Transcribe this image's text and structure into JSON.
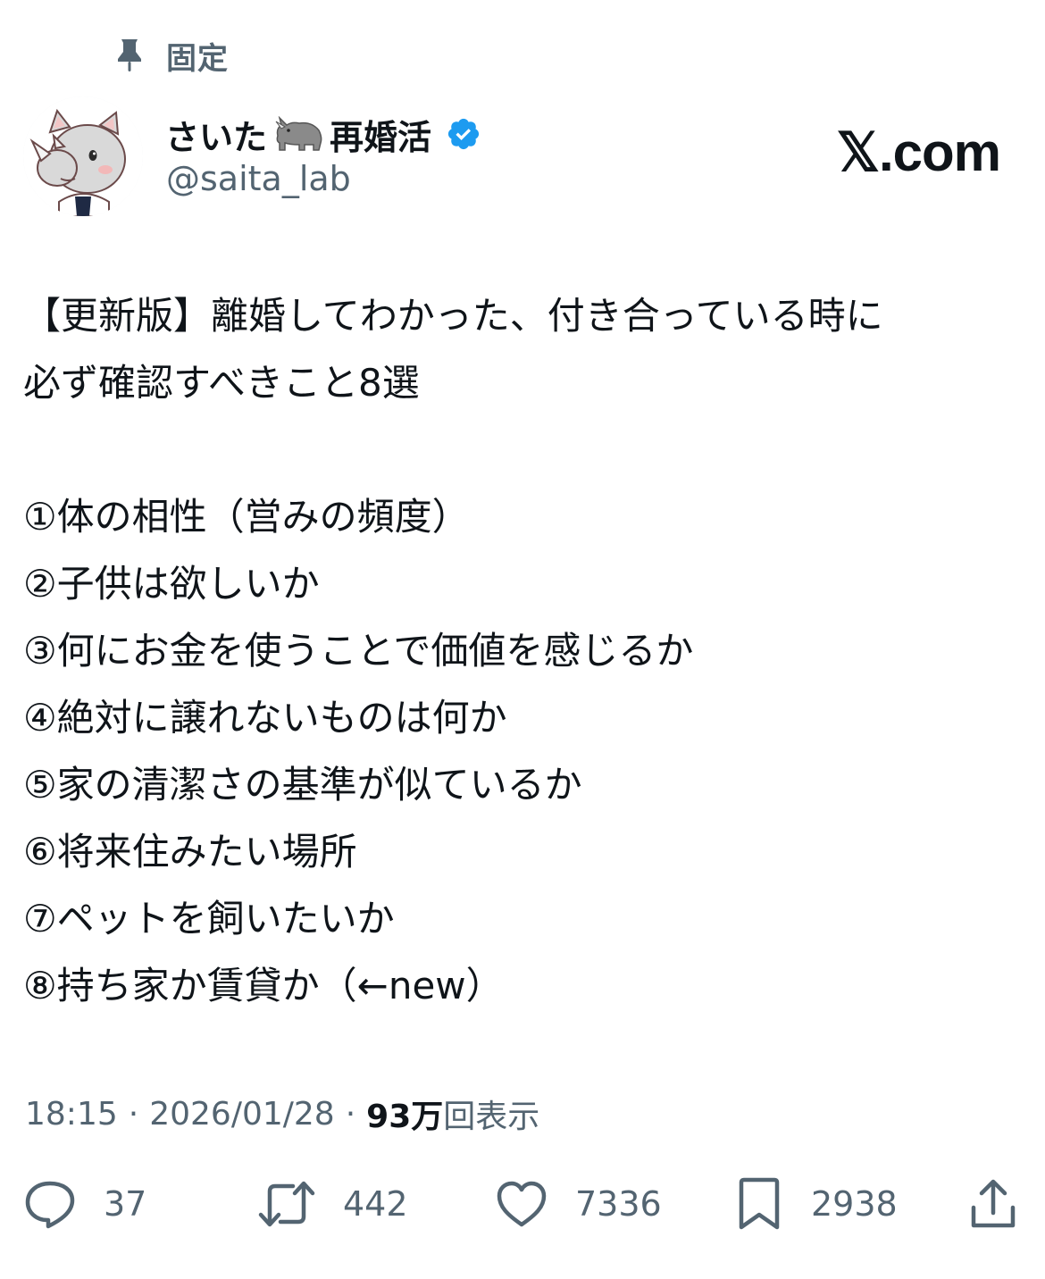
{
  "pinned": {
    "label": "固定",
    "icon": "pin-icon"
  },
  "author": {
    "display_name_part1": "さいた",
    "display_name_emoji": "🦏",
    "display_name_part2": "再婚活",
    "handle": "@saita_lab",
    "verified": true,
    "verified_color": "#1d9bf0",
    "avatar": "rhino-avatar"
  },
  "brand": {
    "logo_text": "𝕏.com"
  },
  "tweet": {
    "lines": [
      "【更新版】離婚してわかった、付き合っている時に",
      "必ず確認すべきこと8選",
      "",
      "①体の相性（営みの頻度）",
      "②子供は欲しいか",
      "③何にお金を使うことで価値を感じるか",
      "④絶対に譲れないものは何か",
      "⑤家の清潔さの基準が似ているか",
      "⑥将来住みたい場所",
      "⑦ペットを飼いたいか",
      "⑧持ち家か賃貸か（←new）"
    ]
  },
  "meta": {
    "time": "18:15",
    "separator": "·",
    "date": "2026/01/28",
    "views_count": "93万",
    "views_label": "回表示"
  },
  "actions": {
    "reply_count": "37",
    "retweet_count": "442",
    "like_count": "7336",
    "bookmark_count": "2938"
  },
  "colors": {
    "text_primary": "#0f1419",
    "text_secondary": "#536471",
    "accent": "#1d9bf0"
  }
}
